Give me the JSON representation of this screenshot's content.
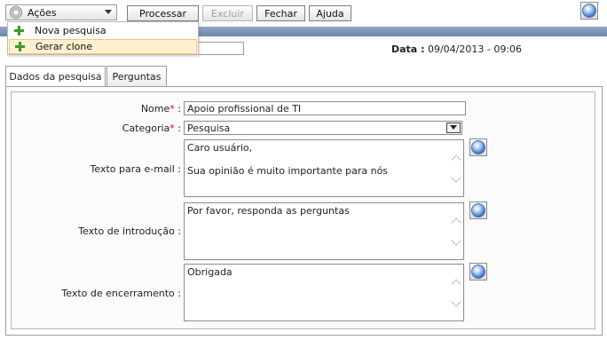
{
  "toolbar": {
    "actions_label": "Ações",
    "buttons": {
      "process": "Processar",
      "delete": "Excluir",
      "close": "Fechar",
      "help": "Ajuda"
    }
  },
  "menu": {
    "items": [
      {
        "label": "Nova pesquisa",
        "icon": "plus-icon"
      },
      {
        "label": "Gerar clone",
        "icon": "plus-icon",
        "highlighted": true
      }
    ]
  },
  "header": {
    "date_label": "Data :",
    "date_value": "09/04/2013 - 09:06"
  },
  "tabs": [
    {
      "label": "Dados da pesquisa",
      "active": true
    },
    {
      "label": "Perguntas",
      "active": false
    }
  ],
  "form": {
    "nome": {
      "label": "Nome",
      "required_mark": "*",
      "colon": ":",
      "value": "Apoio profissional de TI"
    },
    "categoria": {
      "label": "Categoria",
      "required_mark": "*",
      "colon": ":",
      "value": "Pesquisa"
    },
    "texto_email": {
      "label": "Texto para e-mail :",
      "lines": [
        "Caro usuário,",
        "",
        "Sua opinião é muito importante para nós"
      ]
    },
    "texto_intro": {
      "label": "Texto de introdução :",
      "lines": [
        "Por favor, responda as perguntas"
      ]
    },
    "texto_enc": {
      "label": "Texto de encerramento :",
      "lines": [
        "Obrigada"
      ]
    }
  },
  "colors": {
    "header_band": "#7f95bb",
    "required": "#e00000",
    "menu_highlight": "#fdf1cf",
    "plus_icon": "#3d9a2e"
  }
}
